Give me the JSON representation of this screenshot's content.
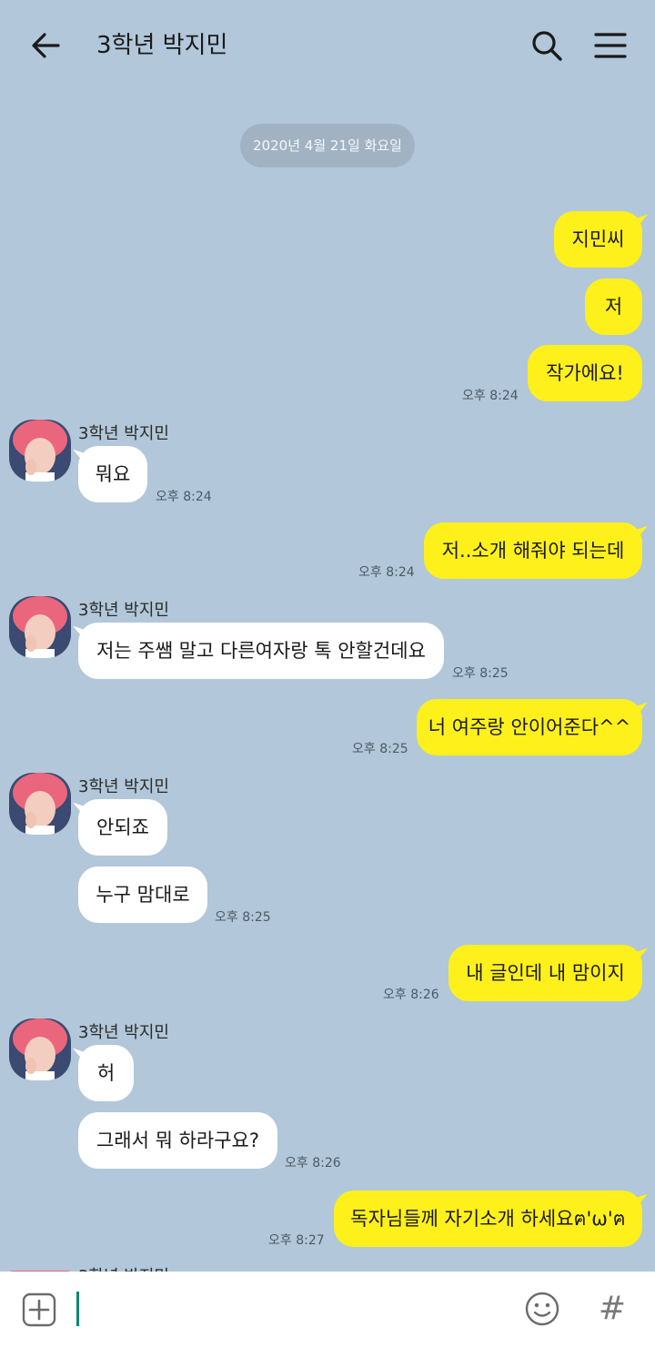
{
  "header": {
    "title": "3학년 박지민",
    "back_icon": "arrow-left-icon",
    "search_icon": "search-icon",
    "menu_icon": "hamburger-menu-icon"
  },
  "date_divider": "2020년 4월 21일 화요일",
  "colors": {
    "background": "#b2c7d9",
    "my_bubble": "#fef01b",
    "their_bubble": "#ffffff",
    "date_pill": "#a1b3c3",
    "caret": "#0b8a6c"
  },
  "contact": {
    "name": "3학년 박지민",
    "avatar_icon": "profile-photo"
  },
  "messages": [
    {
      "from": "me",
      "text": "지민씨"
    },
    {
      "from": "me",
      "text": "저"
    },
    {
      "from": "me",
      "text": "작가에요!",
      "time": "오후 8:24"
    },
    {
      "from": "them",
      "text": "뭐요",
      "time": "오후 8:24"
    },
    {
      "from": "me",
      "text": "저..소개 해줘야 되는데",
      "time": "오후 8:24"
    },
    {
      "from": "them",
      "text": "저는 주쌤 말고 다른여자랑 톡 안할건데요",
      "time": "오후 8:25"
    },
    {
      "from": "me",
      "text": "너 여주랑 안이어준다^^",
      "time": "오후 8:25"
    },
    {
      "from": "them",
      "text": "안되죠"
    },
    {
      "from": "them",
      "text": "누구 맘대로",
      "time": "오후 8:25"
    },
    {
      "from": "me",
      "text": "내 글인데 내 맘이지",
      "time": "오후 8:26"
    },
    {
      "from": "them",
      "text": "허"
    },
    {
      "from": "them",
      "text": "그래서 뭐 하라구요?",
      "time": "오후 8:26"
    },
    {
      "from": "me",
      "text": "독자님들께 자기소개 하세요ฅ'ω'ฅ",
      "time": "오후 8:27"
    }
  ],
  "input_bar": {
    "value": "",
    "add_icon": "plus-square-icon",
    "emoji_icon": "smiley-icon",
    "hash_label": "#"
  }
}
